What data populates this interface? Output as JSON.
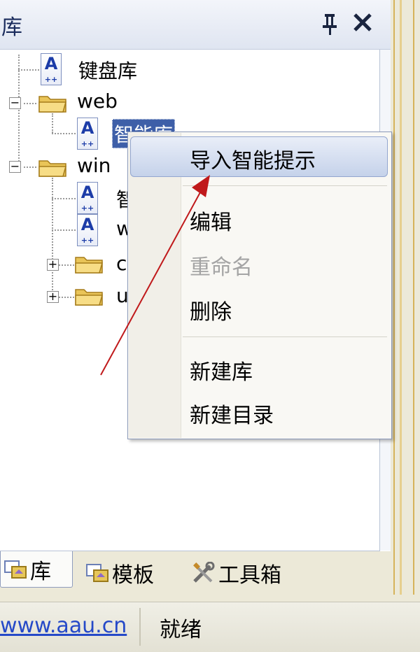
{
  "panel": {
    "title": "库",
    "pin_glyph": "⊥",
    "close_glyph": "✕"
  },
  "tree": {
    "items": [
      {
        "label": "键盘库",
        "type": "library"
      },
      {
        "label": "web",
        "type": "folder",
        "expander": "−"
      },
      {
        "label": "智能库",
        "type": "library"
      },
      {
        "label": "win",
        "type": "folder",
        "expander": "−"
      },
      {
        "label": "智",
        "type": "library"
      },
      {
        "label": "w",
        "type": "library"
      },
      {
        "label": "c",
        "type": "folder",
        "expander": "+"
      },
      {
        "label": "u",
        "type": "folder",
        "expander": "+"
      }
    ]
  },
  "context_menu": {
    "items": [
      {
        "label": "导入智能提示",
        "state": "highlighted"
      },
      {
        "label": "编辑",
        "state": "normal"
      },
      {
        "label": "重命名",
        "state": "disabled"
      },
      {
        "label": "删除",
        "state": "normal"
      },
      {
        "label": "新建库",
        "state": "normal"
      },
      {
        "label": "新建目录",
        "state": "normal"
      }
    ]
  },
  "tabs": [
    {
      "label": "库",
      "icon": "library-tab-icon",
      "active": true
    },
    {
      "label": "模板",
      "icon": "template-tab-icon",
      "active": false
    },
    {
      "label": "工具箱",
      "icon": "toolbox-tab-icon",
      "active": false
    }
  ],
  "status_bar": {
    "link": "www.aau.cn",
    "status": "就绪"
  },
  "colors": {
    "accent": "#1c3ca8",
    "arrow": "#c0191b",
    "highlight": "#c5d2ea",
    "link": "#2549c8"
  }
}
